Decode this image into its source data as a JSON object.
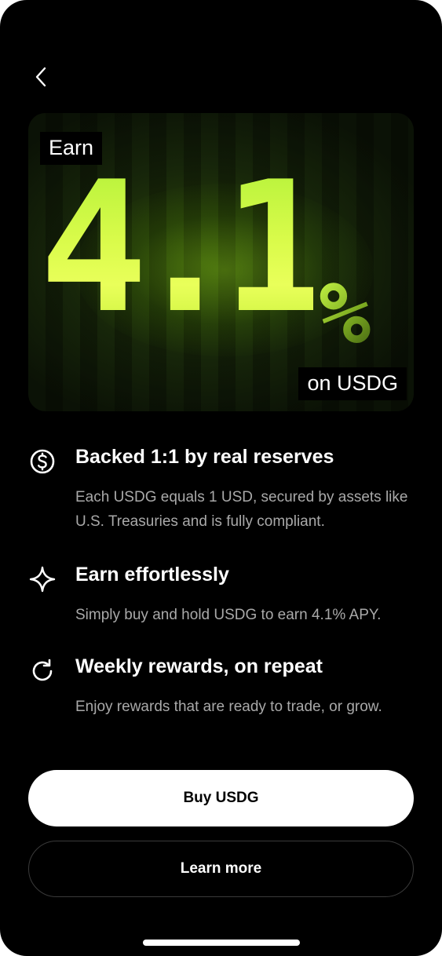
{
  "hero": {
    "earn_label": "Earn",
    "rate_number": "4.1",
    "rate_symbol": "%",
    "on_label": "on USDG",
    "accent_color": "#d9fb4a"
  },
  "features": [
    {
      "icon": "dollar-circle-icon",
      "title": "Backed 1:1 by real reserves",
      "description": "Each USDG equals 1 USD, secured by assets like U.S. Treasuries and is fully compliant."
    },
    {
      "icon": "sparkle-icon",
      "title": "Earn effortlessly",
      "description": "Simply buy and hold USDG to earn 4.1% APY."
    },
    {
      "icon": "refresh-icon",
      "title": "Weekly rewards, on repeat",
      "description": "Enjoy rewards that are ready to trade, or grow."
    }
  ],
  "actions": {
    "primary_label": "Buy USDG",
    "secondary_label": "Learn more"
  },
  "icons": {
    "back": "chevron-left-icon"
  }
}
